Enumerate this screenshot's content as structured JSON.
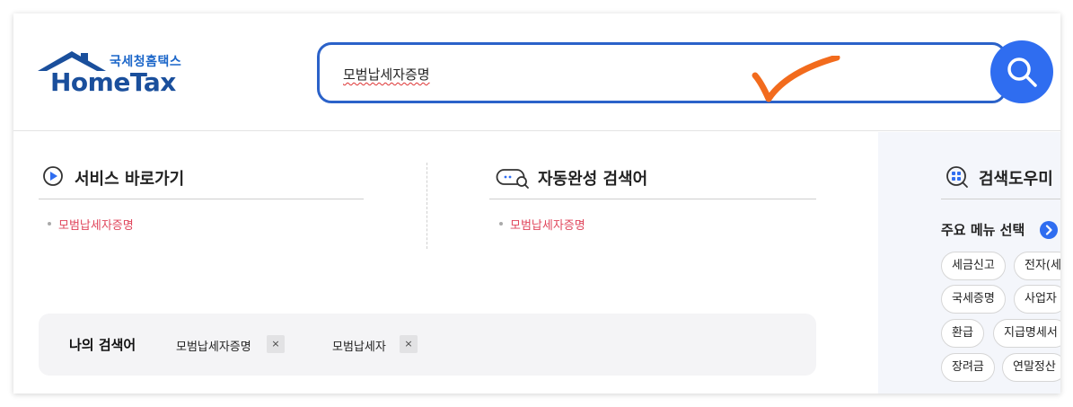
{
  "header": {
    "logo_kor": "국세청홈택스",
    "logo_eng": "HomeTax",
    "search_value": "모범납세자증명",
    "brand_color": "#2f6df0"
  },
  "service_shortcut": {
    "title": "서비스 바로가기",
    "items": [
      "모범납세자증명"
    ]
  },
  "autocomplete": {
    "title": "자동완성 검색어",
    "items": [
      "모범납세자증명"
    ]
  },
  "my_search": {
    "title": "나의 검색어",
    "keywords": [
      "모범납세자증명",
      "모범납세자"
    ],
    "remove_symbol": "×"
  },
  "helper": {
    "title": "검색도우미",
    "menu_title": "주요 메뉴 선택",
    "chips": [
      [
        "세금신고",
        "전자(세"
      ],
      [
        "국세증명",
        "사업자"
      ],
      [
        "환급",
        "지급명세서"
      ],
      [
        "장려금",
        "연말정산"
      ]
    ]
  }
}
